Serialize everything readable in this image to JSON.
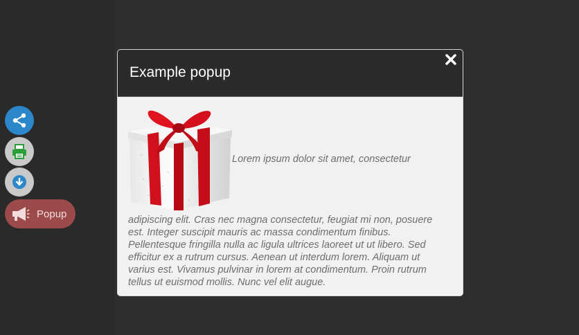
{
  "side_buttons": {
    "share_icon": "share-icon",
    "print_icon": "print-icon",
    "download_icon": "download-icon",
    "popup_label": "Popup",
    "popup_icon": "megaphone-icon"
  },
  "modal": {
    "title": "Example popup",
    "close_icon": "close-icon",
    "image": "gift-box-image",
    "text_first": "Lorem ipsum dolor sit amet, consectetur",
    "text_rest": "adipiscing elit. Cras nec magna consectetur, feugiat mi non, posuere est. Integer suscipit mauris ac massa condimentum finibus. Pellentesque fringilla nulla ac ligula ultrices laoreet ut ut libero. Sed efficitur ex a rutrum cursus. Aenean ut interdum lorem. Aliquam ut varius est. Vivamus pulvinar in lorem at condimentum. Proin rutrum tellus ut euismod mollis. Nunc vel elit augue."
  },
  "colors": {
    "background": "#2e2e2e",
    "share": "#2b87c9",
    "popup_button": "#9c4a4a",
    "modal_header": "#2b2b2b",
    "modal_body": "#f1f1f1",
    "ribbon": "#d0101c"
  }
}
